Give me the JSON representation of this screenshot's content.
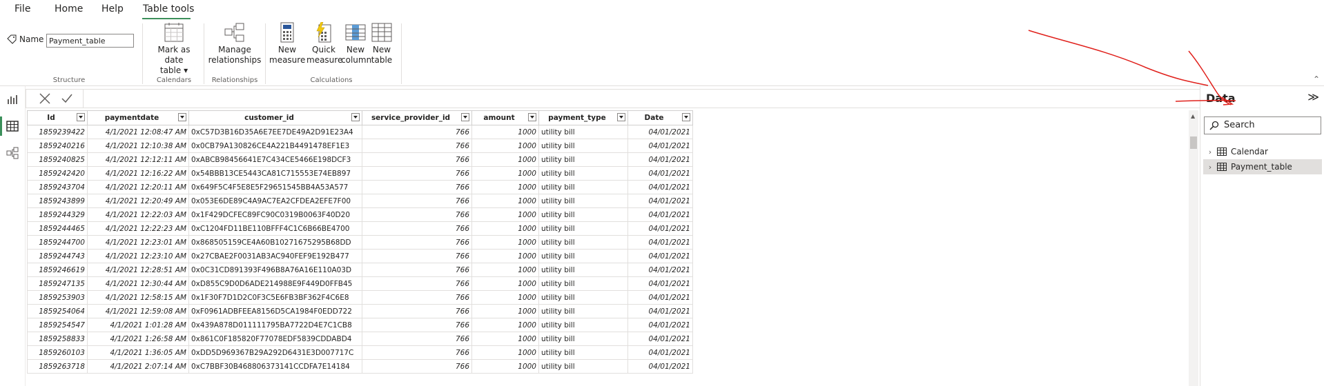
{
  "menu": {
    "items": [
      "File",
      "Home",
      "Help",
      "Table tools"
    ],
    "active": "Table tools"
  },
  "ribbon": {
    "name_label": "Name",
    "name_value": "Payment_table",
    "groups": {
      "structure": "Structure",
      "calendars": "Calendars",
      "relationships": "Relationships",
      "calculations": "Calculations"
    },
    "buttons": {
      "mark_as_date": [
        "Mark as date",
        "table ▾"
      ],
      "manage_rel": [
        "Manage",
        "relationships"
      ],
      "new_measure": [
        "New",
        "measure"
      ],
      "quick_measure": [
        "Quick",
        "measure"
      ],
      "new_column": [
        "New",
        "column"
      ],
      "new_table": [
        "New",
        "table"
      ]
    }
  },
  "table": {
    "columns": [
      "Id",
      "paymentdate",
      "customer_id",
      "service_provider_id",
      "amount",
      "payment_type",
      "Date"
    ],
    "rows": [
      [
        "1859239422",
        "4/1/2021 12:08:47 AM",
        "0xC57D3B16D35A6E7EE7DE49A2D91E23A4",
        "766",
        "1000",
        "utility bill",
        "04/01/2021"
      ],
      [
        "1859240216",
        "4/1/2021 12:10:38 AM",
        "0x0CB79A130826CE4A221B4491478EF1E3",
        "766",
        "1000",
        "utility bill",
        "04/01/2021"
      ],
      [
        "1859240825",
        "4/1/2021 12:12:11 AM",
        "0xABCB98456641E7C434CE5466E198DCF3",
        "766",
        "1000",
        "utility bill",
        "04/01/2021"
      ],
      [
        "1859242420",
        "4/1/2021 12:16:22 AM",
        "0x54BBB13CE5443CA81C715553E74EB897",
        "766",
        "1000",
        "utility bill",
        "04/01/2021"
      ],
      [
        "1859243704",
        "4/1/2021 12:20:11 AM",
        "0x649F5C4F5E8E5F29651545BB4A53A577",
        "766",
        "1000",
        "utility bill",
        "04/01/2021"
      ],
      [
        "1859243899",
        "4/1/2021 12:20:49 AM",
        "0x053E6DE89C4A9AC7EA2CFDEA2EFE7F00",
        "766",
        "1000",
        "utility bill",
        "04/01/2021"
      ],
      [
        "1859244329",
        "4/1/2021 12:22:03 AM",
        "0x1F429DCFEC89FC90C0319B0063F40D20",
        "766",
        "1000",
        "utility bill",
        "04/01/2021"
      ],
      [
        "1859244465",
        "4/1/2021 12:22:23 AM",
        "0xC1204FD11BE110BFFF4C1C6B66BE4700",
        "766",
        "1000",
        "utility bill",
        "04/01/2021"
      ],
      [
        "1859244700",
        "4/1/2021 12:23:01 AM",
        "0x868505159CE4A60B10271675295B68DD",
        "766",
        "1000",
        "utility bill",
        "04/01/2021"
      ],
      [
        "1859244743",
        "4/1/2021 12:23:10 AM",
        "0x27CBAE2F0031AB3AC940FEF9E192B477",
        "766",
        "1000",
        "utility bill",
        "04/01/2021"
      ],
      [
        "1859246619",
        "4/1/2021 12:28:51 AM",
        "0x0C31CD891393F496B8A76A16E110A03D",
        "766",
        "1000",
        "utility bill",
        "04/01/2021"
      ],
      [
        "1859247135",
        "4/1/2021 12:30:44 AM",
        "0xD855C9D0D6ADE214988E9F449D0FFB45",
        "766",
        "1000",
        "utility bill",
        "04/01/2021"
      ],
      [
        "1859253903",
        "4/1/2021 12:58:15 AM",
        "0x1F30F7D1D2C0F3C5E6FB3BF362F4C6E8",
        "766",
        "1000",
        "utility bill",
        "04/01/2021"
      ],
      [
        "1859254064",
        "4/1/2021 12:59:08 AM",
        "0xF0961ADBFEEA8156D5CA1984F0EDD722",
        "766",
        "1000",
        "utility bill",
        "04/01/2021"
      ],
      [
        "1859254547",
        "4/1/2021 1:01:28 AM",
        "0x439A878D011111795BA7722D4E7C1CB8",
        "766",
        "1000",
        "utility bill",
        "04/01/2021"
      ],
      [
        "1859258833",
        "4/1/2021 1:26:58 AM",
        "0x861C0F185820F77078EDF5839CDDABD4",
        "766",
        "1000",
        "utility bill",
        "04/01/2021"
      ],
      [
        "1859260103",
        "4/1/2021 1:36:05 AM",
        "0xDD5D969367B29A292D6431E3D007717C",
        "766",
        "1000",
        "utility bill",
        "04/01/2021"
      ],
      [
        "1859263718",
        "4/1/2021 2:07:14 AM",
        "0xC7BBF30B468806373141CCDFA7E14184",
        "766",
        "1000",
        "utility bill",
        "04/01/2021"
      ]
    ]
  },
  "data_pane": {
    "title": "Data",
    "search_placeholder": "Search",
    "items": [
      "Calendar",
      "Payment_table"
    ],
    "selected": "Payment_table"
  },
  "colors": {
    "accent": "#3b8f5a",
    "annotation": "#e0201b"
  }
}
